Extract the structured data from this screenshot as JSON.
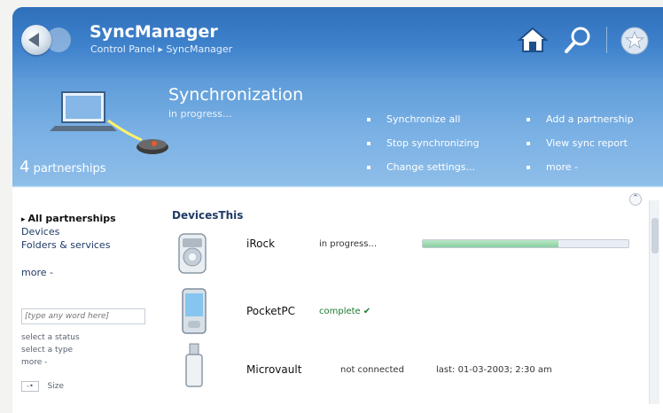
{
  "window": {
    "title": "SyncManager",
    "breadcrumb": "Control Panel ▸ SyncManager"
  },
  "toolbar": {
    "icons": [
      "back-icon",
      "home-icon",
      "search-icon",
      "star-icon"
    ]
  },
  "hero": {
    "title": "Synchronization",
    "status": "in progress...",
    "partnerships_number": "4",
    "partnerships_label": "partnerships",
    "links": [
      "Synchronize all",
      "Stop synchronizing",
      "Change settings...",
      "Add a partnership",
      "View sync report",
      "more -"
    ]
  },
  "sidebar": {
    "items": [
      "All partnerships",
      "Devices",
      "Folders & services"
    ],
    "more": "more -",
    "search_placeholder": "[type any word here]",
    "status_select": "select a status",
    "type_select": "select a type",
    "more_small": "more -",
    "size_label": "Size"
  },
  "list": {
    "header": "DevicesThis",
    "devices": [
      {
        "name": "iRock",
        "status": "in progress...",
        "progress": 0.66
      },
      {
        "name": "PocketPC",
        "status": "complete ✔"
      },
      {
        "name": "Microvault",
        "status": "not connected",
        "last": "last: 01-03-2003; 2:30 am"
      }
    ]
  },
  "colors": {
    "accent": "#3f82cc",
    "complete": "#1d7a2e"
  }
}
